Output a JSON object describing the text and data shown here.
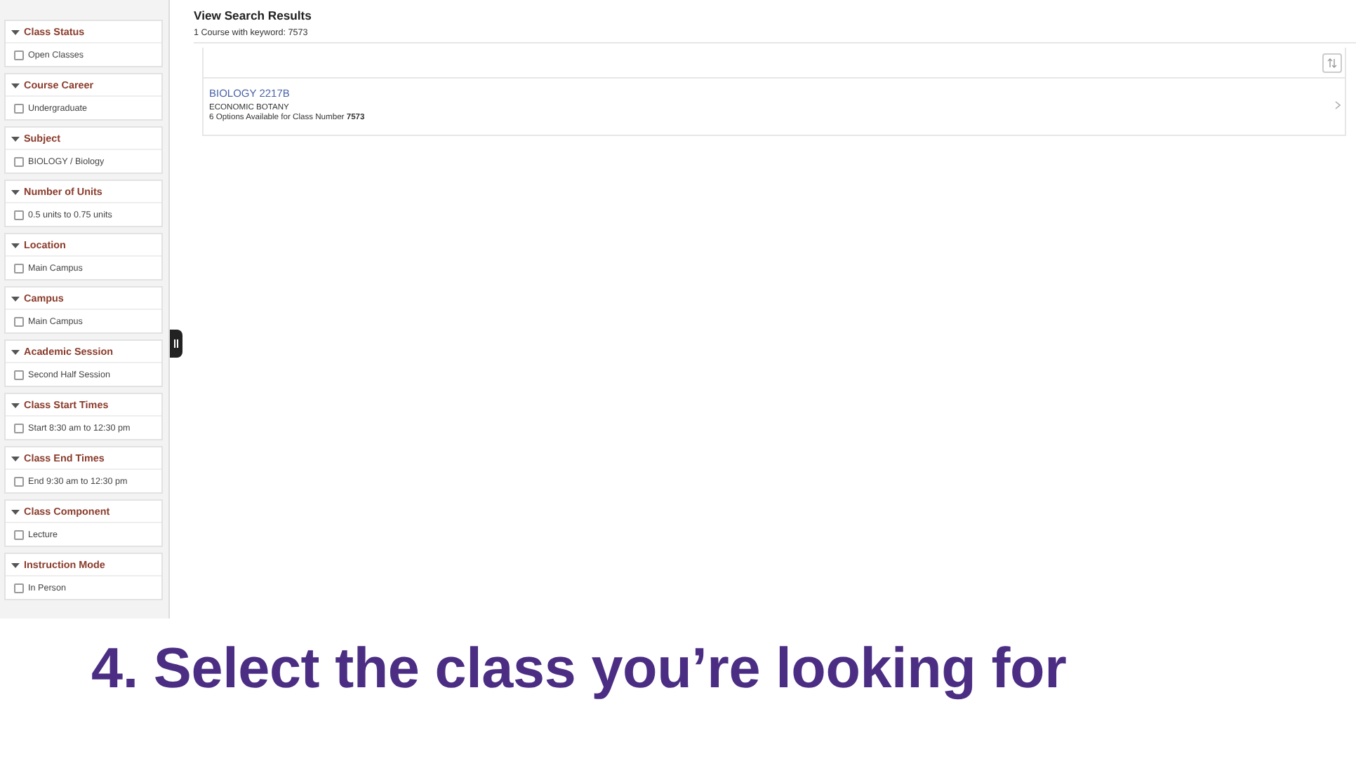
{
  "filters": [
    {
      "title": "Class Status",
      "expanded": true,
      "options": [
        {
          "label": "Open Classes",
          "checked": false
        }
      ]
    },
    {
      "title": "Course Career",
      "expanded": true,
      "options": [
        {
          "label": "Undergraduate",
          "checked": false
        }
      ]
    },
    {
      "title": "Subject",
      "expanded": true,
      "options": [
        {
          "label": "BIOLOGY / Biology",
          "checked": false
        }
      ]
    },
    {
      "title": "Number of Units",
      "expanded": true,
      "options": [
        {
          "label": "0.5 units to 0.75 units",
          "checked": false
        }
      ]
    },
    {
      "title": "Location",
      "expanded": true,
      "options": [
        {
          "label": "Main Campus",
          "checked": false
        }
      ]
    },
    {
      "title": "Campus",
      "expanded": true,
      "options": [
        {
          "label": "Main Campus",
          "checked": false
        }
      ]
    },
    {
      "title": "Academic Session",
      "expanded": true,
      "options": [
        {
          "label": "Second Half Session",
          "checked": false
        }
      ]
    },
    {
      "title": "Class Start Times",
      "expanded": true,
      "options": [
        {
          "label": "Start 8:30 am to 12:30 pm",
          "checked": false
        }
      ]
    },
    {
      "title": "Class End Times",
      "expanded": true,
      "options": [
        {
          "label": "End 9:30 am to 12:30 pm",
          "checked": false
        }
      ]
    },
    {
      "title": "Class Component",
      "expanded": true,
      "options": [
        {
          "label": "Lecture",
          "checked": false
        }
      ]
    },
    {
      "title": "Instruction Mode",
      "expanded": true,
      "options": [
        {
          "label": "In Person",
          "checked": false
        }
      ]
    }
  ],
  "results": {
    "title": "View Search Results",
    "summary": "1 Course with keyword: 7573",
    "courses": [
      {
        "code": "BIOLOGY 2217B",
        "name": "ECONOMIC BOTANY",
        "detail": "6 Options Available for Class Number **7573**"
      }
    ]
  },
  "caption": "4. Select the class you’re looking for"
}
